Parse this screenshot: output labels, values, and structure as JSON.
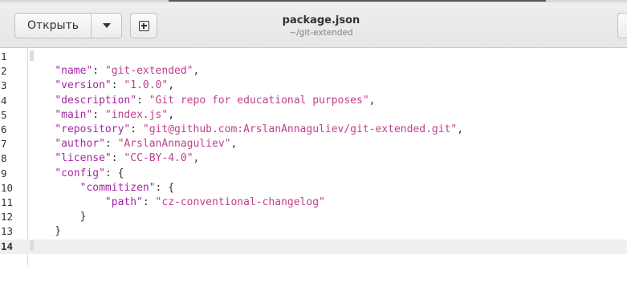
{
  "toolbar": {
    "open_label": "Открыть",
    "menu_icon": "chevron-down-icon",
    "new_icon": "new-document-icon"
  },
  "title": {
    "filename": "package.json",
    "path": "~/git-extended"
  },
  "editor": {
    "current_line": 14,
    "lines": [
      {
        "num": "1",
        "text": ""
      },
      {
        "num": "2",
        "text": "    \"name\": \"git-extended\","
      },
      {
        "num": "3",
        "text": "    \"version\": \"1.0.0\","
      },
      {
        "num": "4",
        "text": "    \"description\": \"Git repo for educational purposes\","
      },
      {
        "num": "5",
        "text": "    \"main\": \"index.js\","
      },
      {
        "num": "6",
        "text": "    \"repository\": \"git@github.com:ArslanAnnaguliev/git-extended.git\","
      },
      {
        "num": "7",
        "text": "    \"author\": \"ArslanAnnaguliev\","
      },
      {
        "num": "8",
        "text": "    \"license\": \"CC-BY-4.0\","
      },
      {
        "num": "9",
        "text": "    \"config\": {"
      },
      {
        "num": "10",
        "text": "        \"commitizen\": {"
      },
      {
        "num": "11",
        "text": "            \"path\": \"cz-conventional-changelog\""
      },
      {
        "num": "12",
        "text": "        }"
      },
      {
        "num": "13",
        "text": "    }"
      },
      {
        "num": "14",
        "text": ""
      }
    ]
  },
  "colors": {
    "key": "#a626a4",
    "string": "#c0408e",
    "current_line_bg": "#efefef"
  }
}
